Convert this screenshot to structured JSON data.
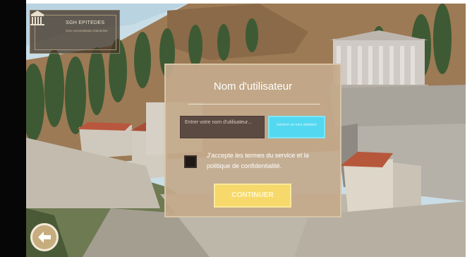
{
  "logo": {
    "title": "SGH EPITEDES",
    "subtitle": "Grec reconstitution interactive",
    "icon": "temple-icon"
  },
  "dialog": {
    "title": "Nom d'utilisateur",
    "name_input_placeholder": "Entrer votre nom d'utilisateur...",
    "lookup_button_label": "Générer un nom aléatoire",
    "terms_label": "J'accepte les termes du service et la politique de confidentialité.",
    "terms_checked": false,
    "continue_label": "CONTINUER"
  },
  "navigation": {
    "back_icon": "arrow-left-icon"
  },
  "colors": {
    "dialog_bg": "#c4aa8c",
    "input_bg": "#5b4a42",
    "lookup_button": "#52d8f0",
    "continue_button": "#f6d96a",
    "back_button": "#c7ad7d"
  }
}
